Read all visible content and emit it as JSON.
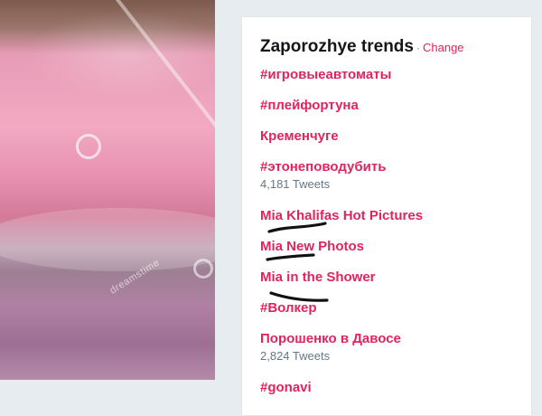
{
  "trends_panel": {
    "title": "Zaporozhye trends",
    "separator": "·",
    "change_label": "Change",
    "accent_color": "#e0245e",
    "items": [
      {
        "name": "#игровыеавтоматы"
      },
      {
        "name": "#плейфортуна"
      },
      {
        "name": "Кременчуге"
      },
      {
        "name": "#этонеповодубить",
        "tweets": "4,181 Tweets"
      },
      {
        "name": "Mia Khalifas Hot Pictures"
      },
      {
        "name": "Mia New Photos"
      },
      {
        "name": "Mia in the Shower"
      },
      {
        "name": "#Волкер"
      },
      {
        "name": "Порошенко в Давосе",
        "tweets": "2,824 Tweets"
      },
      {
        "name": "#gonavi"
      }
    ]
  },
  "photo": {
    "watermark": "dreamstime"
  }
}
